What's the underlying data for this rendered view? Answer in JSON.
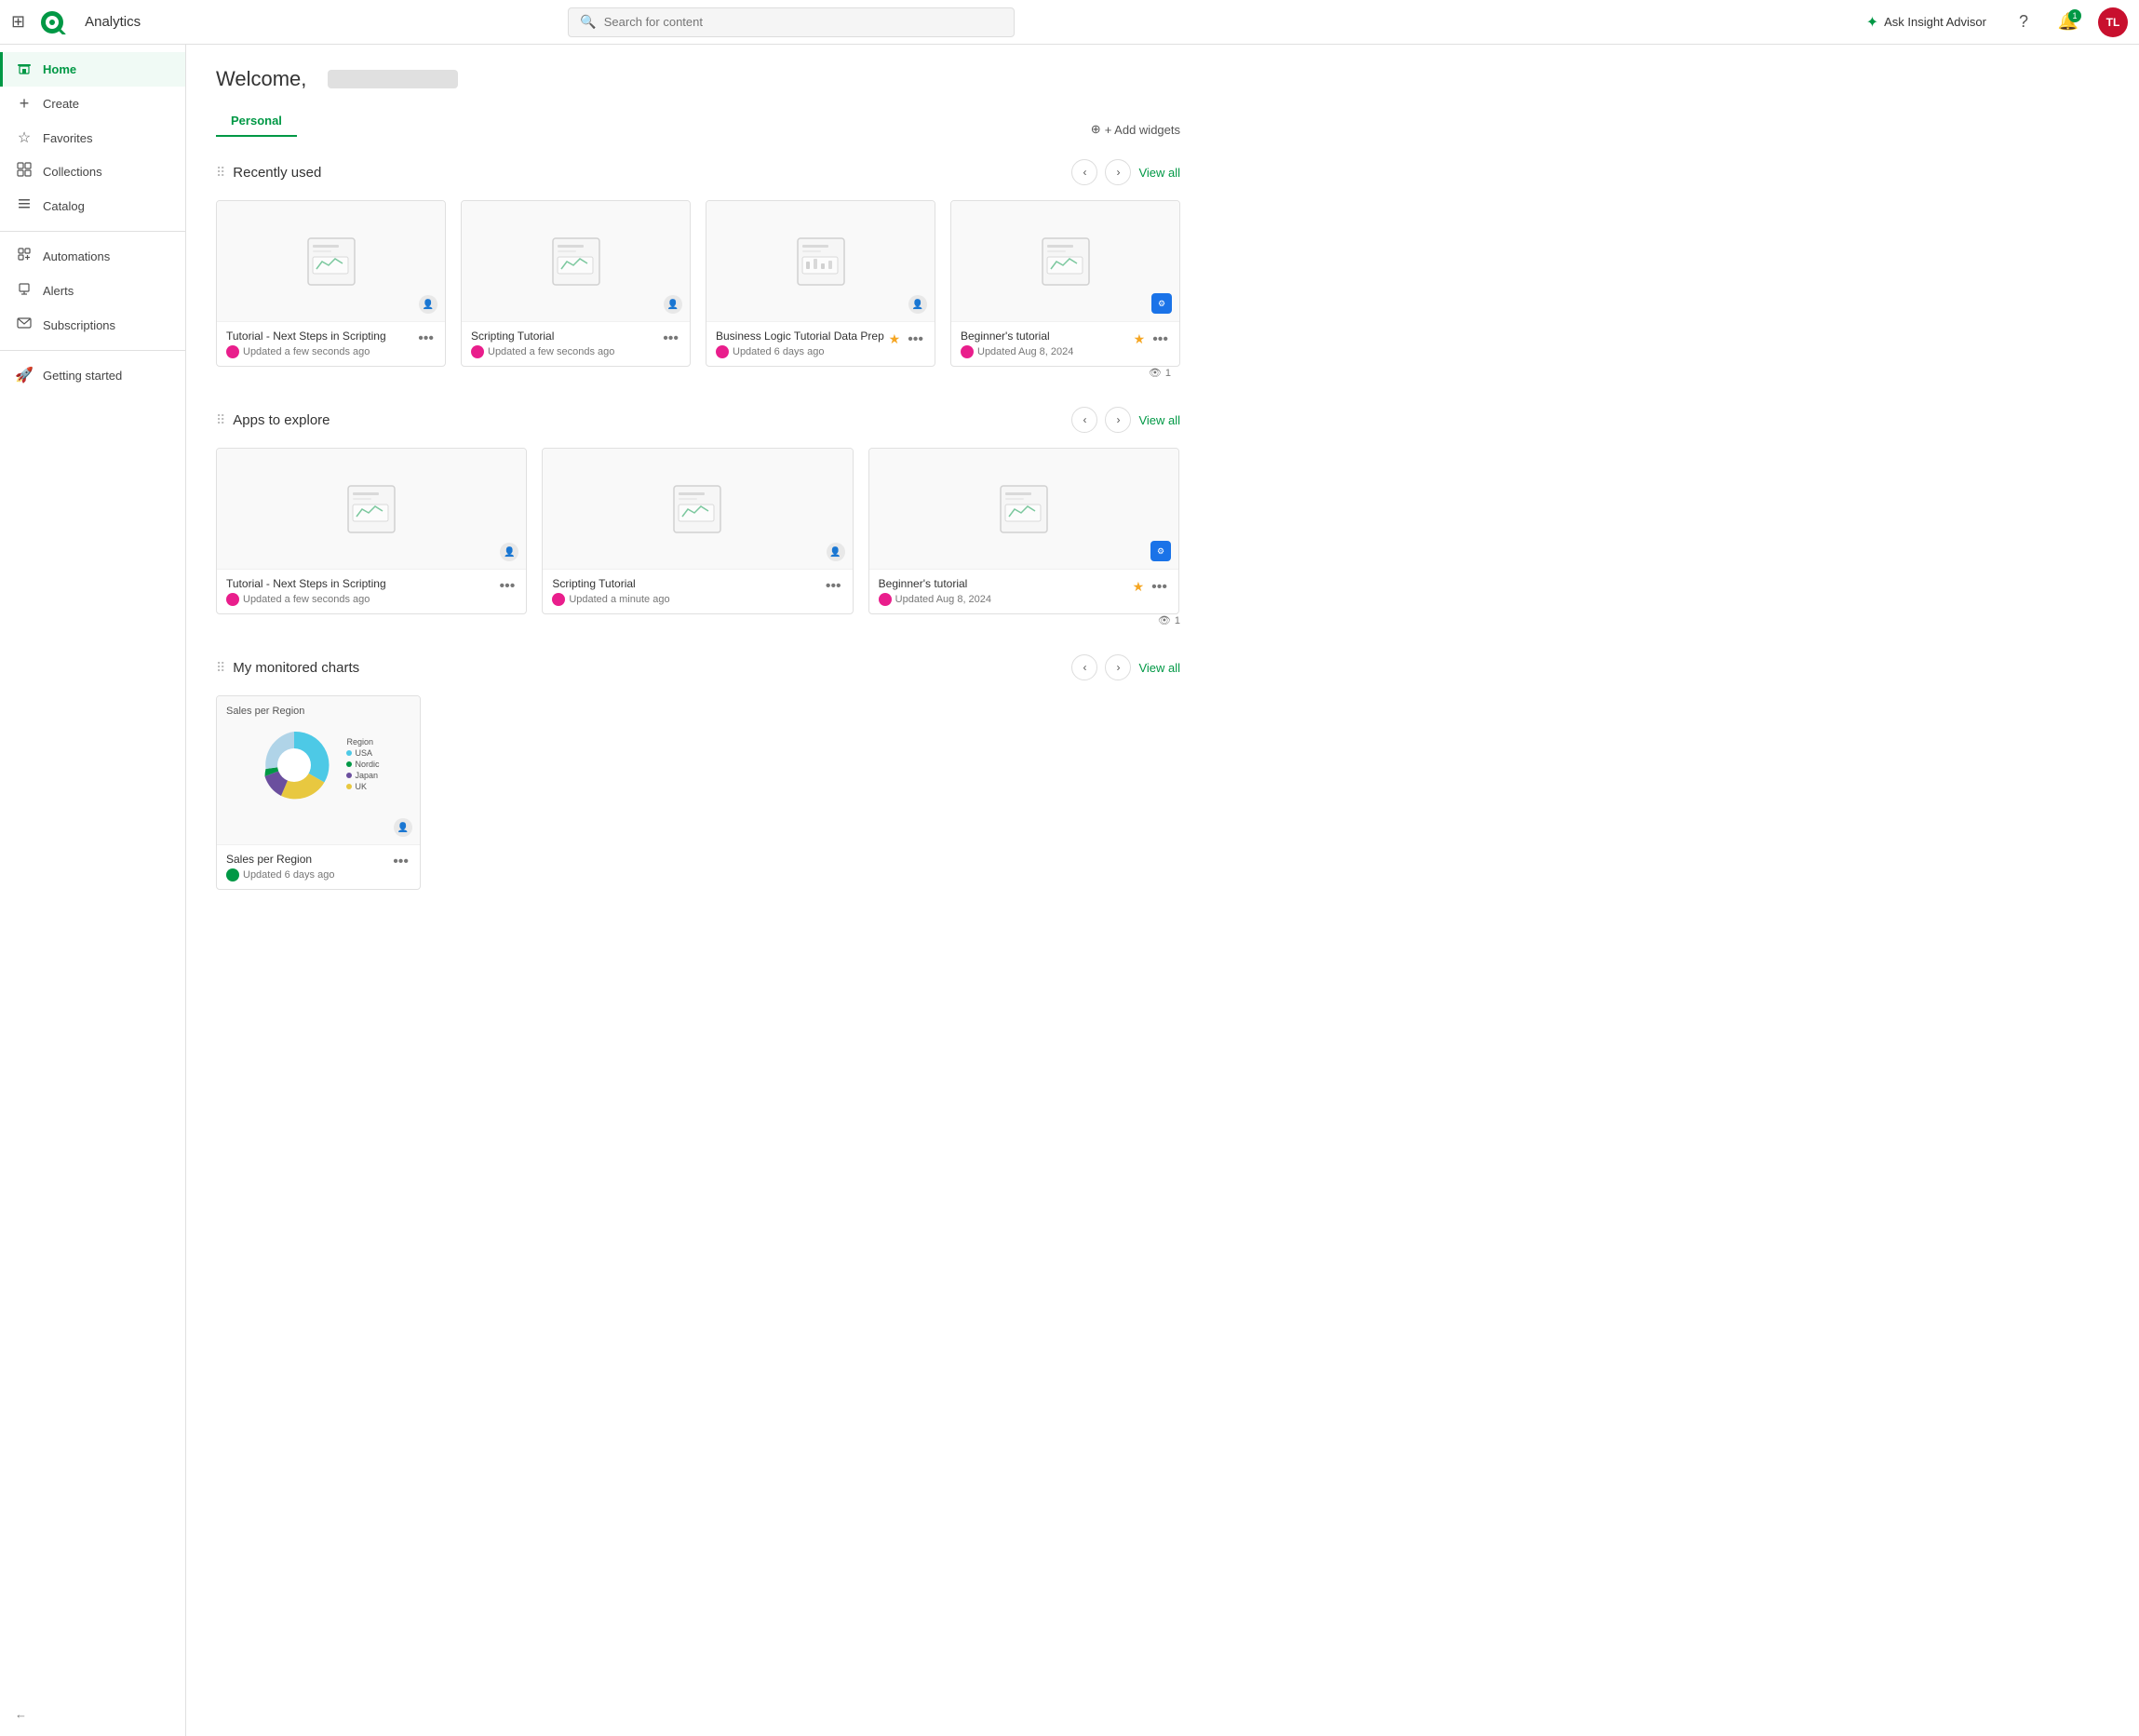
{
  "app": {
    "name": "Analytics"
  },
  "topnav": {
    "search_placeholder": "Search for content",
    "insight_advisor_label": "Ask Insight Advisor",
    "notification_count": "1",
    "avatar_initials": "TL"
  },
  "sidebar": {
    "items": [
      {
        "id": "home",
        "label": "Home",
        "icon": "⌂",
        "active": true
      },
      {
        "id": "create",
        "label": "Create",
        "icon": "+",
        "active": false
      },
      {
        "id": "favorites",
        "label": "Favorites",
        "icon": "☆",
        "active": false
      },
      {
        "id": "collections",
        "label": "Collections",
        "icon": "⊞",
        "active": false
      },
      {
        "id": "catalog",
        "label": "Catalog",
        "icon": "≡",
        "active": false
      },
      {
        "id": "automations",
        "label": "Automations",
        "icon": "⚙",
        "active": false
      },
      {
        "id": "alerts",
        "label": "Alerts",
        "icon": "🔔",
        "active": false
      },
      {
        "id": "subscriptions",
        "label": "Subscriptions",
        "icon": "✉",
        "active": false
      },
      {
        "id": "getting-started",
        "label": "Getting started",
        "icon": "🚀",
        "active": false
      }
    ],
    "collapse_label": "←"
  },
  "main": {
    "welcome_text": "Welcome,",
    "add_widgets_label": "+ Add widgets",
    "tabs": [
      {
        "id": "personal",
        "label": "Personal",
        "active": true
      }
    ],
    "recently_used": {
      "title": "Recently used",
      "view_all": "View all",
      "cards": [
        {
          "title": "Tutorial - Next Steps in Scripting",
          "meta": "Updated a few seconds ago",
          "avatar_class": "pink",
          "starred": false,
          "badge": "user"
        },
        {
          "title": "Scripting Tutorial",
          "meta": "Updated a few seconds ago",
          "avatar_class": "pink",
          "starred": false,
          "badge": "user"
        },
        {
          "title": "Business Logic Tutorial Data Prep",
          "meta": "Updated 6 days ago",
          "avatar_class": "pink",
          "starred": true,
          "badge": "user"
        },
        {
          "title": "Beginner's tutorial",
          "meta": "Updated Aug 8, 2024",
          "avatar_class": "pink",
          "starred": true,
          "badge": "blue"
        }
      ],
      "views_count": "1"
    },
    "apps_to_explore": {
      "title": "Apps to explore",
      "view_all": "View all",
      "cards": [
        {
          "title": "Tutorial - Next Steps in Scripting",
          "meta": "Updated a few seconds ago",
          "avatar_class": "pink",
          "starred": false,
          "badge": "user"
        },
        {
          "title": "Scripting Tutorial",
          "meta": "Updated a minute ago",
          "avatar_class": "pink",
          "starred": false,
          "badge": "user"
        },
        {
          "title": "Beginner's tutorial",
          "meta": "Updated Aug 8, 2024",
          "avatar_class": "pink",
          "starred": true,
          "badge": "blue"
        }
      ],
      "views_count": "1"
    },
    "monitored_charts": {
      "title": "My monitored charts",
      "view_all": "View all",
      "chart": {
        "title": "Sales per Region",
        "meta": "Updated 6 days ago",
        "avatar_class": "green",
        "legend": [
          {
            "label": "USA",
            "value": "45.5%",
            "color": "#4dc9e6"
          },
          {
            "label": "Nordic",
            "value": "3.3%",
            "color": "#009845"
          },
          {
            "label": "Japan",
            "value": "12.3%",
            "color": "#6b4f9e"
          },
          {
            "label": "UK",
            "value": "26.9%",
            "color": "#e8c840"
          }
        ]
      }
    }
  }
}
